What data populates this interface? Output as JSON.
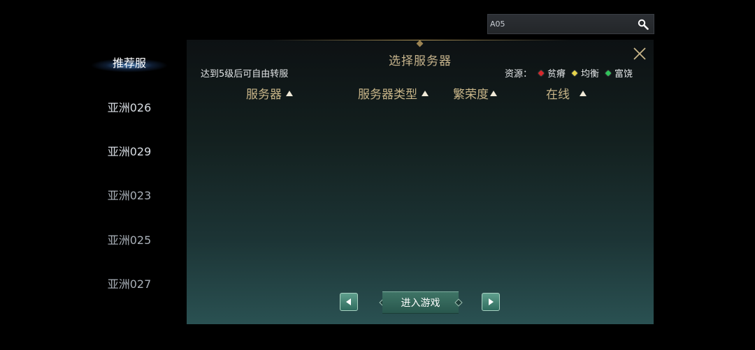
{
  "search": {
    "value": "A05"
  },
  "sidebar": {
    "items": [
      {
        "label": "推荐服",
        "state": "active"
      },
      {
        "label": "亚洲026",
        "state": "normal"
      },
      {
        "label": "亚洲029",
        "state": "normal"
      },
      {
        "label": "亚洲023",
        "state": "dim"
      },
      {
        "label": "亚洲025",
        "state": "dim"
      },
      {
        "label": "亚洲027",
        "state": "dim"
      }
    ]
  },
  "panel": {
    "title": "选择服务器",
    "hint": "达到5级后可自由转服",
    "legend": {
      "label": "资源：",
      "items": [
        {
          "label": "贫瘠",
          "color": "#d8262a"
        },
        {
          "label": "均衡",
          "color": "#e6d44a"
        },
        {
          "label": "富饶",
          "color": "#2fc45a"
        }
      ]
    },
    "columns": {
      "server": "服务器",
      "type": "服务器类型",
      "prosperity": "繁荣度",
      "online": "在线"
    },
    "enter_button": "进入游戏"
  },
  "colors": {
    "accent_gold": "#c9b689",
    "button_green": "#3f7466"
  }
}
